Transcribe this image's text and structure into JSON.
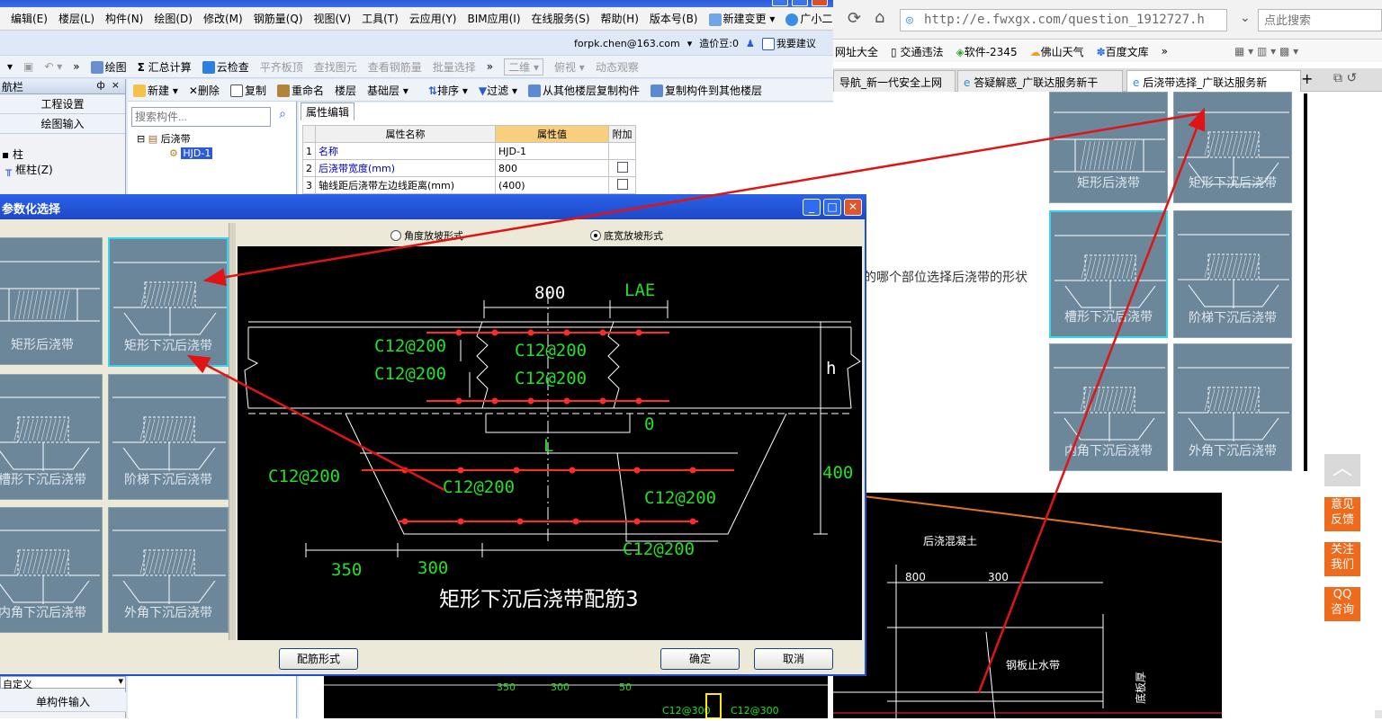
{
  "app": {
    "menu": [
      "编辑(E)",
      "楼层(L)",
      "构件(N)",
      "绘图(D)",
      "修改(M)",
      "钢筋量(Q)",
      "视图(V)",
      "工具(T)",
      "云应用(Y)",
      "BIM应用(I)",
      "在线服务(S)",
      "帮助(H)",
      "版本号(B)",
      "新建变更",
      "广小二"
    ],
    "account": "forpk.chen@163.com",
    "beans": "造价豆:0",
    "suggest": "我要建议",
    "toolbar1": {
      "draw": "绘图",
      "sum": "汇总计算",
      "cloud_check": "云检查",
      "flat_slab": "平齐板顶",
      "find": "查找图元",
      "view_rebar": "查看钢筋量",
      "batch_select": "批量选择",
      "view2d": "二维",
      "top_view": "俯视",
      "dynamic": "动态观察"
    },
    "toolbar2": {
      "new": "新建",
      "delete": "删除",
      "copy": "复制",
      "rename": "重命名",
      "floor": "楼层",
      "base_floor": "基础层",
      "sort": "排序",
      "filter": "过滤",
      "copy_from": "从其他楼层复制构件",
      "copy_to": "复制构件到其他楼层"
    },
    "side": {
      "title": "航栏",
      "pin": "ф",
      "close": "×",
      "project_settings": "工程设置",
      "draw_input": "绘图输入",
      "col": "柱",
      "frame_col": "框柱(Z)",
      "custom": "自定义",
      "single_input": "单构件输入"
    },
    "search_placeholder": "搜索构件...",
    "tree": {
      "root": "后浇带",
      "item": "HJD-1"
    },
    "props": {
      "tab": "属性编辑",
      "headers": [
        "属性名称",
        "属性值",
        "附加"
      ],
      "rows": [
        {
          "no": "1",
          "name": "名称",
          "value": "HJD-1"
        },
        {
          "no": "2",
          "name": "后浇带宽度(mm)",
          "value": "800"
        },
        {
          "no": "3",
          "name": "轴线距后浇带左边线距离(mm)",
          "value": "(400)"
        }
      ]
    },
    "bottom_labels": [
      "350",
      "300",
      "50",
      "C12@300",
      "C12@300"
    ]
  },
  "dialog": {
    "title": "参数化选择",
    "radio_angle": "角度放坡形式",
    "radio_bottom": "底宽放坡形式",
    "thumbs": [
      "矩形后浇带",
      "矩形下沉后浇带",
      "槽形下沉后浇带",
      "阶梯下沉后浇带",
      "内角下沉后浇带",
      "外角下沉后浇带"
    ],
    "btn_rebar": "配筋形式",
    "btn_ok": "确定",
    "btn_cancel": "取消",
    "drawing": {
      "w800": "800",
      "lae": "LAE",
      "rebar_label": "C12@200",
      "h": "h",
      "zero": "0",
      "L": "L",
      "d400": "400",
      "d350": "350",
      "d300": "300",
      "caption": "矩形下沉后浇带配筋3"
    }
  },
  "browser": {
    "url": "http://e.fwxgx.com/question_1912727.h",
    "search_placeholder": "点此搜索",
    "bookmarks": [
      "网址大全",
      "交通违法",
      "软件-2345",
      "佛山天气",
      "百度文库"
    ],
    "tabs": [
      "导航_新一代安全上网",
      "答疑解惑_广联达服务新干",
      "后浇带选择_广联达服务新"
    ],
    "question_text": "的哪个部位选择后浇带的形状",
    "thumbs": [
      "矩形后浇带",
      "矩形下沉后浇带",
      "槽形下沉后浇带",
      "阶梯下沉后浇带",
      "内角下沉后浇带",
      "外角下沉后浇带"
    ],
    "float": [
      "意见\n反馈",
      "关注\n我们",
      "QQ\n咨询"
    ],
    "cad": {
      "label1": "后浇混凝土",
      "d800": "800",
      "d300": "300",
      "label2": "钢板止水带",
      "label3": "底板厚"
    }
  },
  "colors": {
    "rebar": "#ff2a2a",
    "dim": "#23e023",
    "cad_bg": "#000000",
    "thumb": "#6b8799",
    "sel": "#38d4ec",
    "accent": "#f06a1c"
  }
}
